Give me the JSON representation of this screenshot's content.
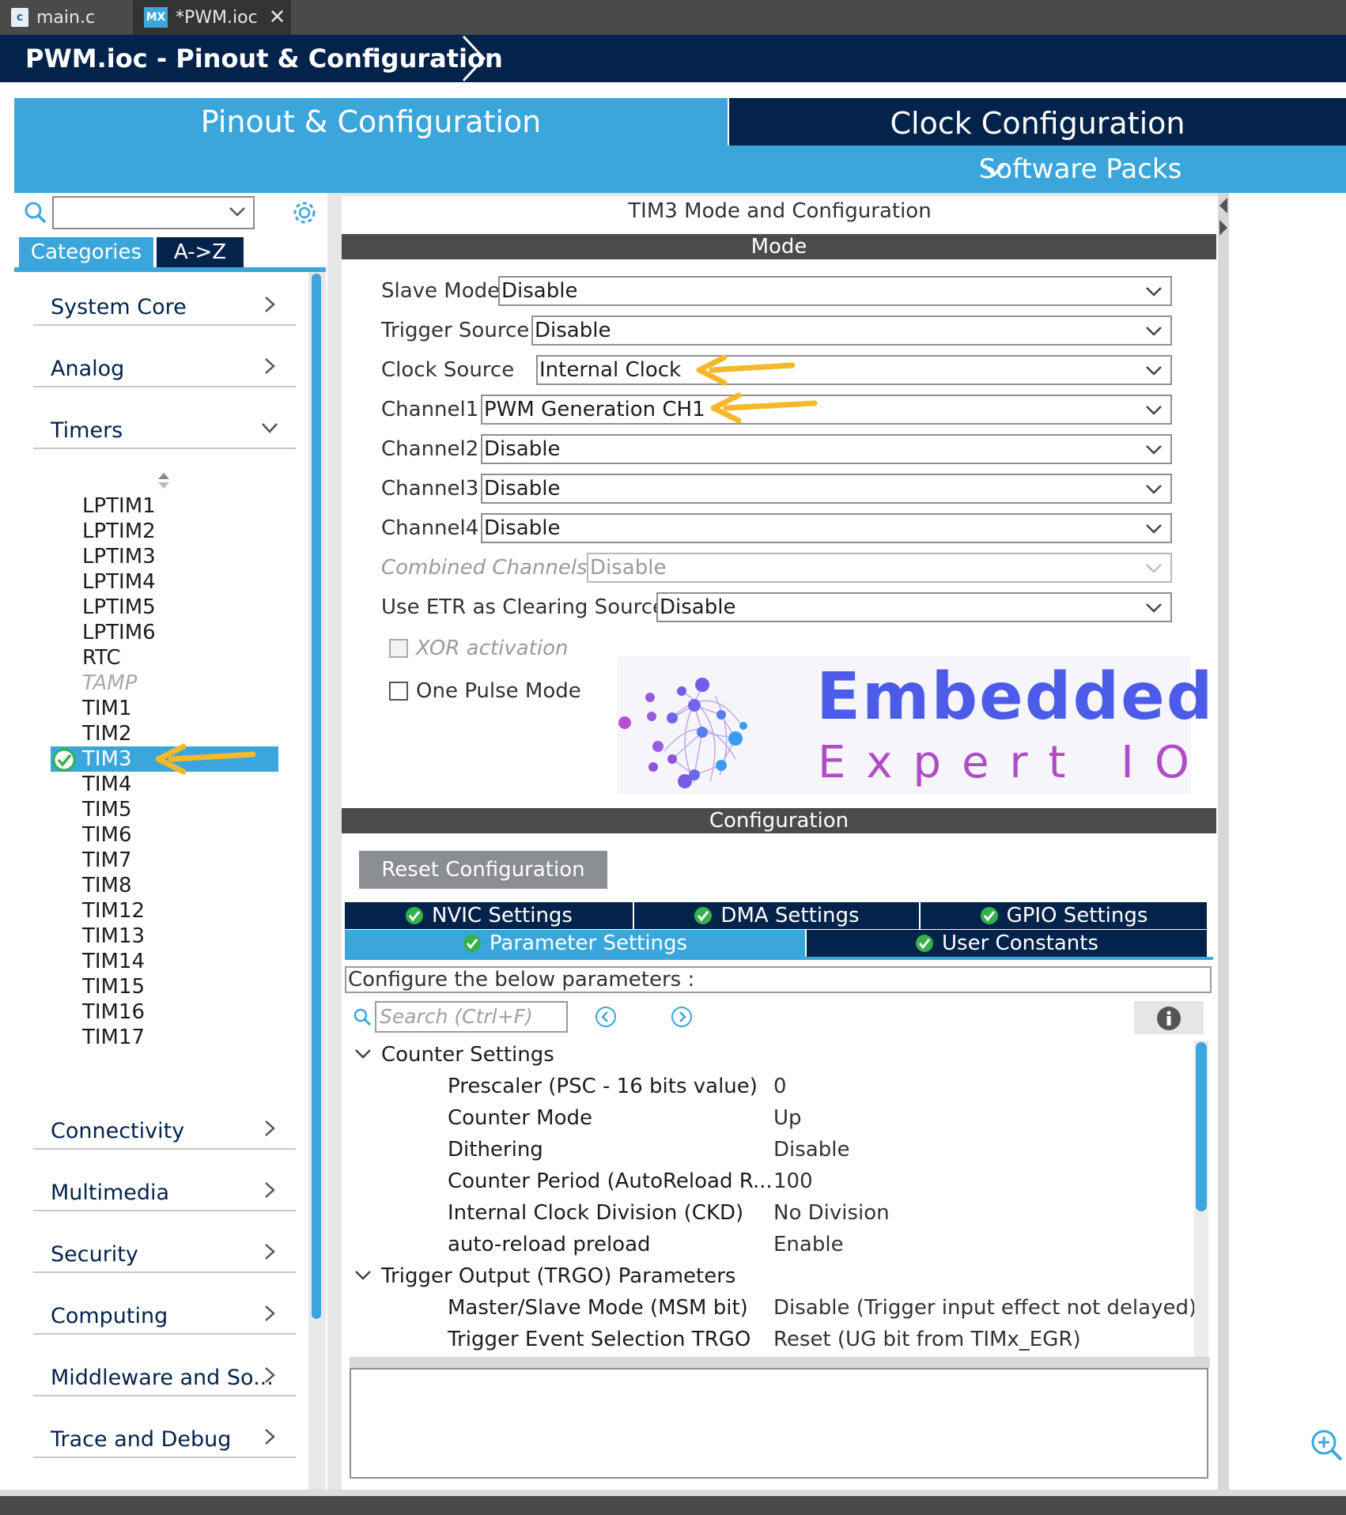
{
  "editor_tabs": [
    {
      "label": "main.c",
      "icon": "c-file-icon"
    },
    {
      "label": "*PWM.ioc",
      "icon": "mx-file-icon"
    }
  ],
  "editor_tab_icon_text": {
    "c": "c",
    "mx": "MX"
  },
  "breadcrumb": {
    "title": "PWM.ioc - Pinout & Configuration"
  },
  "main_tabs": {
    "pinout": "Pinout & Configuration",
    "clock": "Clock Configuration",
    "software_packs": "Software Packs"
  },
  "left_panel": {
    "search_value": "",
    "view_buttons": {
      "categories": "Categories",
      "atoz": "A->Z"
    },
    "categories_top": [
      "System Core",
      "Analog",
      "Timers"
    ],
    "timers": [
      "LPTIM1",
      "LPTIM2",
      "LPTIM3",
      "LPTIM4",
      "LPTIM5",
      "LPTIM6",
      "RTC",
      "TAMP",
      "TIM1",
      "TIM2",
      "TIM3",
      "TIM4",
      "TIM5",
      "TIM6",
      "TIM7",
      "TIM8",
      "TIM12",
      "TIM13",
      "TIM14",
      "TIM15",
      "TIM16",
      "TIM17"
    ],
    "disabled_timers": [
      "TAMP"
    ],
    "selected_timer": "TIM3",
    "categories_bottom": [
      "Connectivity",
      "Multimedia",
      "Security",
      "Computing",
      "Middleware and So...",
      "Trace and Debug"
    ]
  },
  "mode_panel": {
    "title": "TIM3 Mode and Configuration",
    "mode_header": "Mode",
    "fields": [
      {
        "label": "Slave Mode",
        "value": "Disable",
        "disabled": false
      },
      {
        "label": "Trigger Source",
        "value": "Disable",
        "disabled": false
      },
      {
        "label": "Clock Source",
        "value": "Internal Clock",
        "disabled": false
      },
      {
        "label": "Channel1",
        "value": "PWM Generation CH1",
        "disabled": false
      },
      {
        "label": "Channel2",
        "value": "Disable",
        "disabled": false
      },
      {
        "label": "Channel3",
        "value": "Disable",
        "disabled": false
      },
      {
        "label": "Channel4",
        "value": "Disable",
        "disabled": false
      },
      {
        "label": "Combined Channels",
        "value": "Disable",
        "disabled": true
      },
      {
        "label": "Use ETR as Clearing Source",
        "value": "Disable",
        "disabled": false
      }
    ],
    "checkboxes": [
      {
        "label": "XOR activation",
        "checked": false,
        "disabled": true
      },
      {
        "label": "One Pulse Mode",
        "checked": false,
        "disabled": false
      }
    ]
  },
  "watermark": {
    "line1": "Embedded",
    "line2": "Expert IO"
  },
  "configuration": {
    "header": "Configuration",
    "reset_button": "Reset Configuration",
    "tabs_row1": [
      "NVIC Settings",
      "DMA Settings",
      "GPIO Settings"
    ],
    "tabs_row2": [
      "Parameter Settings",
      "User Constants"
    ],
    "active_tab": "Parameter Settings",
    "hint": "Configure the below parameters :",
    "search_placeholder": "Search (Ctrl+F)",
    "groups": [
      {
        "name": "Counter Settings",
        "params": [
          {
            "name": "Prescaler (PSC - 16 bits value)",
            "value": "0"
          },
          {
            "name": "Counter Mode",
            "value": "Up"
          },
          {
            "name": "Dithering",
            "value": "Disable"
          },
          {
            "name": "Counter Period (AutoReload R...",
            "value": "100"
          },
          {
            "name": "Internal Clock Division (CKD)",
            "value": "No Division"
          },
          {
            "name": "auto-reload preload",
            "value": "Enable"
          }
        ]
      },
      {
        "name": "Trigger Output (TRGO) Parameters",
        "params": [
          {
            "name": "Master/Slave Mode (MSM bit)",
            "value": "Disable (Trigger input effect not delayed)"
          },
          {
            "name": "Trigger Event Selection TRGO",
            "value": "Reset (UG bit from TIMx_EGR)"
          }
        ]
      }
    ]
  },
  "colors": {
    "accent_blue": "#3aa6dc",
    "navy": "#03234b",
    "section_bar": "#4b4b4b",
    "annotation_arrow": "#f5b82a",
    "check_green": "#35b04a"
  }
}
